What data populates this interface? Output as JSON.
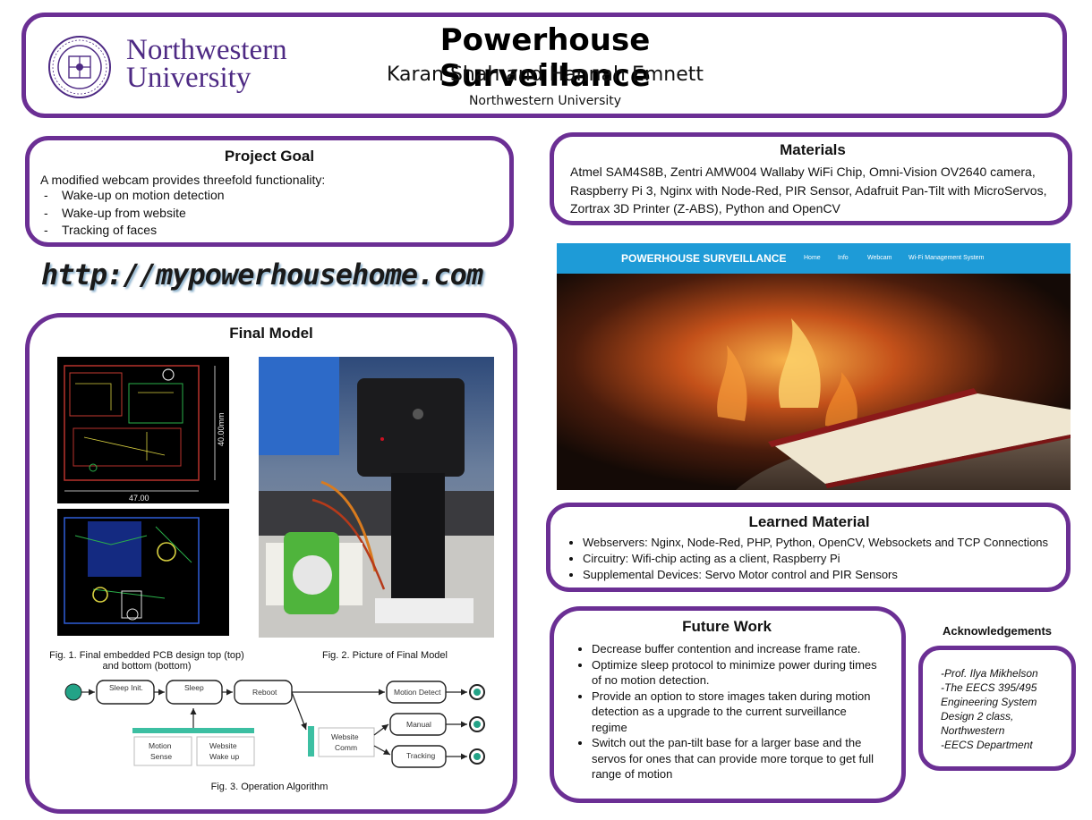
{
  "header": {
    "title": "Powerhouse Surveillance",
    "authors": "Karan Shah and Hannah Emnett",
    "affiliation": "Northwestern University",
    "logo": {
      "line1": "Northwestern",
      "line2": "University",
      "seal_text": "NORTHWESTERN UNIVERSITY · 1851 ·"
    }
  },
  "project_goal": {
    "title": "Project Goal",
    "intro": "A modified webcam provides threefold functionality:",
    "items": [
      "Wake-up on motion detection",
      "Wake-up from website",
      "Tracking of faces"
    ]
  },
  "url": "http://mypowerhousehome.com",
  "materials": {
    "title": "Materials",
    "text": "Atmel SAM4S8B, Zentri AMW004 Wallaby WiFi Chip, Omni-Vision OV2640 camera, Raspberry Pi 3, Nginx with Node-Red, PIR Sensor, Adafruit Pan-Tilt with MicroServos, Zortrax 3D Printer (Z-ABS), Python and OpenCV"
  },
  "website": {
    "brand": "POWERHOUSE SURVEILLANCE",
    "nav": [
      "Home",
      "Info",
      "Webcam",
      "Wi-Fi Management System"
    ]
  },
  "final_model": {
    "title": "Final Model",
    "pcb_dims": {
      "width": "47.00",
      "height": "40.00mm"
    },
    "fig1": "Fig. 1. Final embedded PCB design top (top) and bottom (bottom)",
    "fig2": "Fig. 2. Picture of Final Model",
    "fig3": "Fig. 3. Operation Algorithm",
    "flow": {
      "sleep_init": "Sleep Init.",
      "sleep": "Sleep",
      "reboot": "Reboot",
      "motion_detect": "Motion Detect",
      "manual": "Manual",
      "tracking": "Tracking",
      "motion_sense_1": "Motion",
      "motion_sense_2": "Sense",
      "website_wake_1": "Website",
      "website_wake_2": "Wake up",
      "website_comm_1": "Website",
      "website_comm_2": "Comm"
    }
  },
  "learned": {
    "title": "Learned Material",
    "items": [
      "Webservers: Nginx, Node-Red, PHP, Python, OpenCV, Websockets and TCP Connections",
      "Circuitry: Wifi-chip acting as a client, Raspberry Pi",
      "Supplemental Devices: Servo Motor control and PIR Sensors"
    ]
  },
  "future": {
    "title": "Future Work",
    "items": [
      "Decrease buffer contention and increase frame rate.",
      "Optimize sleep protocol to minimize power during times of no motion detection.",
      "Provide an option to store images taken during motion detection as a upgrade to the current surveillance regime",
      "Switch out the pan-tilt base for a larger base and the servos for ones that can provide more torque to get full range of motion"
    ]
  },
  "acknowledgements": {
    "title": "Acknowledgements",
    "lines": [
      "-Prof. Ilya Mikhelson",
      "-The EECS 395/495",
      "Engineering System",
      "Design 2 class,",
      "Northwestern",
      "-EECS Department"
    ]
  },
  "colors": {
    "accent": "#6b2f94",
    "nav_blue": "#1e9bd7",
    "nw_purple": "#4e2a84"
  }
}
